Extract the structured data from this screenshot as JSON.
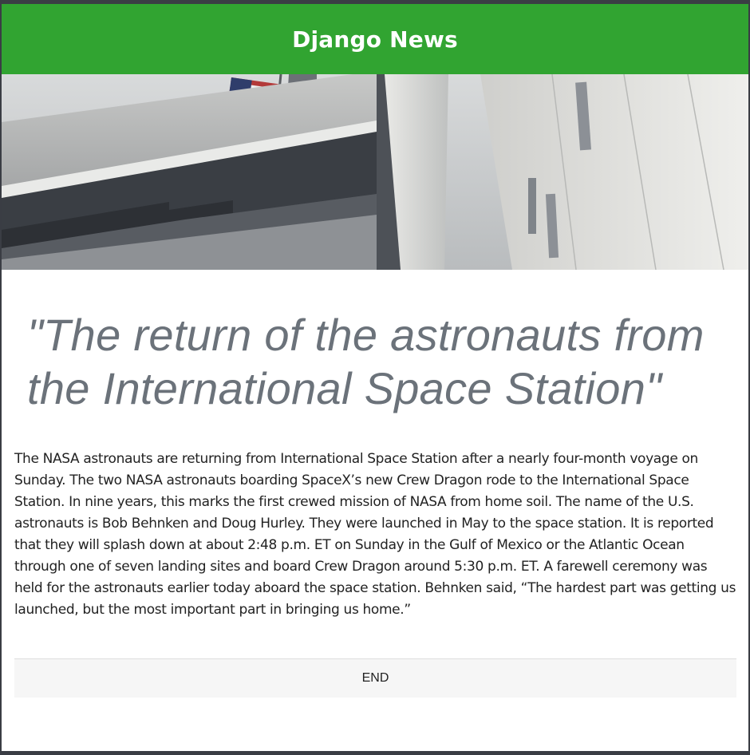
{
  "navbar": {
    "brand": "Django News"
  },
  "hero": {
    "image_description": "Building facade with American flag",
    "colors": {
      "sky": "#c9ccce",
      "wall_light": "#e6e6e4",
      "wall_dark": "#3b3f45",
      "flag_red": "#b23a3a",
      "flag_blue": "#2f3d6b"
    }
  },
  "article": {
    "title": "\"The return of the astronauts from the International Space Station\"",
    "body": "The NASA astronauts are returning from International Space Station after a nearly four-month voyage on Sunday. The two NASA astronauts boarding SpaceX’s new Crew Dragon rode to the International Space Station. In nine years, this marks the first crewed mission of NASA from home soil. The name of the U.S. astronauts is Bob Behnken and Doug Hurley. They were launched in May to the space station. It is reported that they will splash down at about 2:48 p.m. ET on Sunday in the Gulf of Mexico or the Atlantic Ocean through one of seven landing sites and board Crew Dragon around 5:30 p.m. ET. A farewell ceremony was held for the astronauts earlier today aboard the space station. Behnken said, “The hardest part was getting us launched, but the most important part in bringing us home.”"
  },
  "footer": {
    "end_label": "END"
  },
  "theme": {
    "navbar_bg": "#31a431",
    "title_color": "#6b727a",
    "end_bg": "#f6f6f6"
  }
}
